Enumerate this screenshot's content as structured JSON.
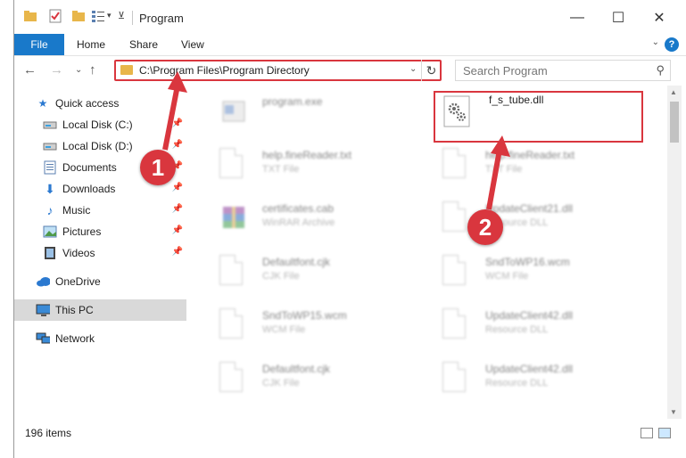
{
  "window": {
    "title": "Program",
    "minimize_glyph": "—",
    "maximize_glyph": "☐",
    "close_glyph": "✕"
  },
  "ribbon": {
    "file_tab": "File",
    "tabs": [
      "Home",
      "Share",
      "View"
    ],
    "help_glyph": "?"
  },
  "address_bar": {
    "path": "C:\\Program Files\\Program Directory",
    "refresh_glyph": "↻"
  },
  "search": {
    "placeholder": "Search Program"
  },
  "nav_pane": {
    "items": [
      {
        "label": "Quick access",
        "icon": "star-icon"
      },
      {
        "label": "Local Disk (C:)",
        "icon": "drive-icon",
        "pinned": true
      },
      {
        "label": "Local Disk (D:)",
        "icon": "drive-icon",
        "pinned": true
      },
      {
        "label": "Documents",
        "icon": "documents-icon",
        "pinned": true
      },
      {
        "label": "Downloads",
        "icon": "downloads-icon",
        "pinned": true
      },
      {
        "label": "Music",
        "icon": "music-icon",
        "pinned": true
      },
      {
        "label": "Pictures",
        "icon": "pictures-icon",
        "pinned": true
      },
      {
        "label": "Videos",
        "icon": "videos-icon",
        "pinned": true
      },
      {
        "label": "OneDrive",
        "icon": "cloud-icon"
      },
      {
        "label": "This PC",
        "icon": "computer-icon",
        "selected": true
      },
      {
        "label": "Network",
        "icon": "network-icon"
      }
    ]
  },
  "files": [
    {
      "name": "program.exe",
      "type": "",
      "icon": "exe-icon",
      "blurred": true
    },
    {
      "name": "f_s_tube.dll",
      "type": "",
      "icon": "dll-gear-icon",
      "blurred": false
    },
    {
      "name": "help.fineReader.txt",
      "type": "TXT File",
      "icon": "text-file-icon",
      "blurred": true
    },
    {
      "name": "help.fineReader.txt",
      "type": "TXT File",
      "icon": "text-file-icon",
      "blurred": true
    },
    {
      "name": "certificates.cab",
      "type": "WinRAR Archive",
      "icon": "archive-icon",
      "blurred": true
    },
    {
      "name": "UpdateClient21.dll",
      "type": "Resource DLL",
      "icon": "dll-gear-icon",
      "blurred": true
    },
    {
      "name": "Defaultfont.cjk",
      "type": "CJK File",
      "icon": "blank-file-icon",
      "blurred": true
    },
    {
      "name": "SndToWP16.wcm",
      "type": "WCM File",
      "icon": "blank-file-icon",
      "blurred": true
    },
    {
      "name": "SndToWP15.wcm",
      "type": "WCM File",
      "icon": "blank-file-icon",
      "blurred": true
    },
    {
      "name": "UpdateClient42.dll",
      "type": "Resource DLL",
      "icon": "dll-gear-icon",
      "blurred": true
    },
    {
      "name": "Defaultfont.cjk",
      "type": "CJK File",
      "icon": "blank-file-icon",
      "blurred": true
    },
    {
      "name": "UpdateClient42.dll",
      "type": "Resource DLL",
      "icon": "dll-gear-icon",
      "blurred": true
    }
  ],
  "status": {
    "item_count": "196 items"
  },
  "annotations": {
    "callout_1": "1",
    "callout_2": "2",
    "color": "#d9363e"
  }
}
